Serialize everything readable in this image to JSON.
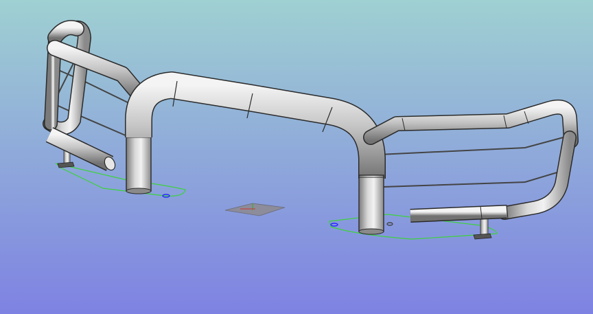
{
  "viewport": {
    "background_top": "#9fd0d2",
    "background_bottom": "#7e82e2"
  },
  "model": {
    "tube_light": "#f2f2f2",
    "tube_mid": "#bdbdbd",
    "tube_dark": "#6f6f6f",
    "outline": "#2a2a2a",
    "footprint_color": "#3cd23c",
    "marker_color": "#2a2aff",
    "bracket_color": "#9a9a9a"
  }
}
